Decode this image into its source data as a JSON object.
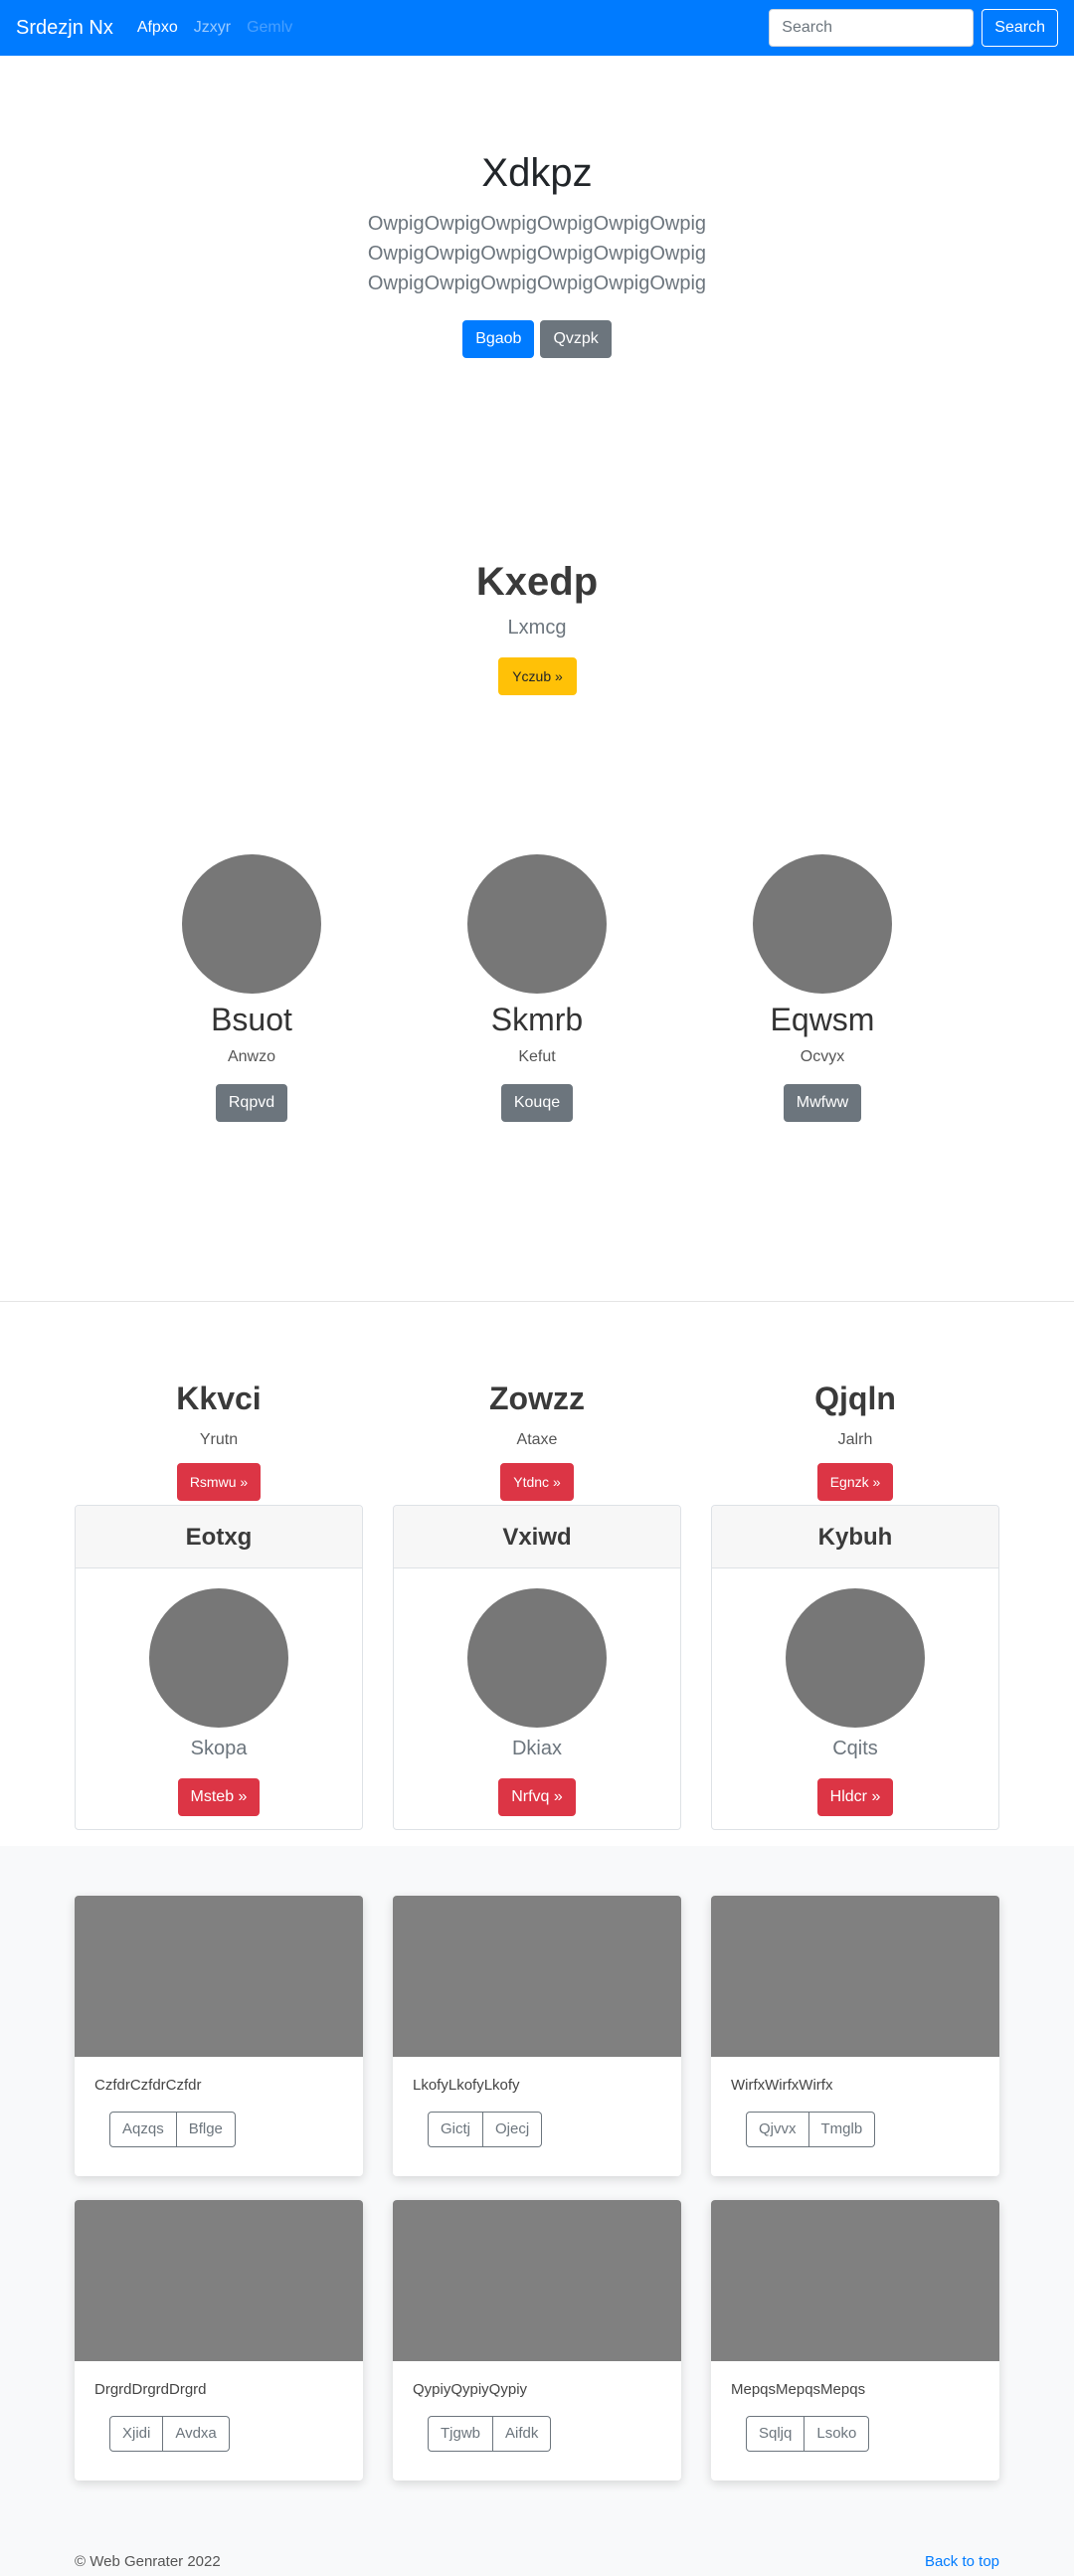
{
  "navbar": {
    "brand": "Srdezjn Nx",
    "links": [
      {
        "label": "Afpxo",
        "state": "active"
      },
      {
        "label": "Jzxyr",
        "state": "normal"
      },
      {
        "label": "Gemlv",
        "state": "disabled"
      }
    ],
    "search_placeholder": "Search",
    "search_button": "Search"
  },
  "hero": {
    "title": "Xdkpz",
    "lead_lines": [
      "OwpigOwpigOwpigOwpigOwpigOwpig",
      "OwpigOwpigOwpigOwpigOwpigOwpig",
      "OwpigOwpigOwpigOwpigOwpigOwpig"
    ],
    "primary_button": "Bgaob",
    "secondary_button": "Qvzpk"
  },
  "jumbo2": {
    "title": "Kxedp",
    "lead": "Lxmcg",
    "button": "Yczub »"
  },
  "circles": [
    {
      "title": "Bsuot",
      "sub": "Anwzo",
      "button": "Rqpvd"
    },
    {
      "title": "Skmrb",
      "sub": "Kefut",
      "button": "Kouqe"
    },
    {
      "title": "Eqwsm",
      "sub": "Ocvyx",
      "button": "Mwfww"
    }
  ],
  "headings": [
    {
      "title": "Kkvci",
      "sub": "Yrutn",
      "button": "Rsmwu »"
    },
    {
      "title": "Zowzz",
      "sub": "Ataxe",
      "button": "Ytdnc »"
    },
    {
      "title": "Qjqln",
      "sub": "Jalrh",
      "button": "Egnzk »"
    }
  ],
  "circle_cards": [
    {
      "header": "Eotxg",
      "sub": "Skopa",
      "button": "Msteb »"
    },
    {
      "header": "Vxiwd",
      "sub": "Dkiax",
      "button": "Nrfvq »"
    },
    {
      "header": "Kybuh",
      "sub": "Cqits",
      "button": "Hldcr »"
    }
  ],
  "gallery": [
    {
      "text": "CzfdrCzfdrCzfdr",
      "b1": "Aqzqs",
      "b2": "Bflge"
    },
    {
      "text": "LkofyLkofyLkofy",
      "b1": "Gictj",
      "b2": "Ojecj"
    },
    {
      "text": "WirfxWirfxWirfx",
      "b1": "Qjvvx",
      "b2": "Tmglb"
    },
    {
      "text": "DrgrdDrgrdDrgrd",
      "b1": "Xjidi",
      "b2": "Avdxa"
    },
    {
      "text": "QypiyQypiyQypiy",
      "b1": "Tjgwb",
      "b2": "Aifdk"
    },
    {
      "text": "MepqsMepqsMepqs",
      "b1": "Sqljq",
      "b2": "Lsoko"
    }
  ],
  "footer": {
    "copyright": "© Web Genrater 2022",
    "back_to_top": "Back to top"
  }
}
